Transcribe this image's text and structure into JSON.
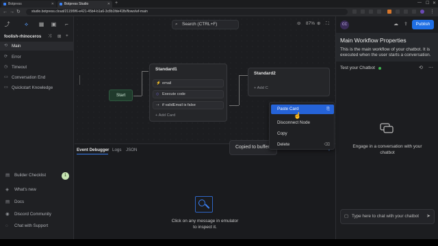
{
  "browser": {
    "tabs": [
      {
        "label": "Botpress"
      },
      {
        "label": "Botpress Studio"
      }
    ],
    "new_tab": "+",
    "url": "studio.botpress.cloud/2115f9f6-e421-45b4-b1a6-3c8b1fde41fb/flows/wf-main"
  },
  "toolbar": {
    "bot_name": "foolish-rhinoceros"
  },
  "workflows": [
    {
      "label": "Main",
      "active": true,
      "icon": "⟲"
    },
    {
      "label": "Error",
      "active": false,
      "icon": "⟳"
    },
    {
      "label": "Timeout",
      "active": false,
      "icon": "◷"
    },
    {
      "label": "Conversation End",
      "active": false,
      "icon": "▭"
    },
    {
      "label": "Quickstart Knowledge",
      "active": false,
      "icon": "▭"
    }
  ],
  "bottom_nav": [
    {
      "label": "Builder Checklist",
      "icon": "▤"
    },
    {
      "label": "What's new",
      "icon": "◈"
    },
    {
      "label": "Docs",
      "icon": "▤"
    },
    {
      "label": "Discord Community",
      "icon": "◉"
    },
    {
      "label": "Chat with Support",
      "icon": "◌"
    }
  ],
  "checklist_count": "1",
  "canvas": {
    "search_placeholder": "Search (CTRL+F)",
    "zoom": "87%"
  },
  "nodes": {
    "start": "Start",
    "standard1": {
      "title": "Standard1",
      "cards": [
        {
          "label": "email",
          "icon": "⚡"
        },
        {
          "label": "Execute code",
          "icon": "◇"
        },
        {
          "label": "if validEmail is false",
          "icon": "⇢"
        }
      ],
      "add_card": "+ Add Card"
    },
    "standard2": {
      "title": "Standard2",
      "add_card": "+ Add C"
    }
  },
  "context_menu": {
    "items": [
      {
        "label": "Paste Card",
        "shortcut": "⎘",
        "highlighted": true
      },
      {
        "label": "Disconnect Node",
        "shortcut": "",
        "highlighted": false
      },
      {
        "label": "Copy",
        "shortcut": "",
        "highlighted": false
      },
      {
        "label": "Delete",
        "shortcut": "⌫",
        "highlighted": false
      }
    ]
  },
  "toast": "Copied to buffer",
  "debugger": {
    "tabs": [
      "Event Debugger",
      "Logs",
      "JSON"
    ],
    "empty_line1": "Click on any message in emulator",
    "empty_line2": "to inspect it."
  },
  "right_panel": {
    "avatar": "CC",
    "publish": "Publish",
    "props_title": "Main Workflow Properties",
    "props_desc": "This is the main workflow of your chatbot. It is executed when the user starts a conversation.",
    "test_title": "Test your Chatbot",
    "chat_empty_line1": "Engage in a conversation with your",
    "chat_empty_line2": "chatbot",
    "chat_placeholder": "Type here to chat with your chatbot"
  },
  "colors": {
    "accent": "#2563d8",
    "publish": "#1f6fe5",
    "start_node": "#203a2c",
    "status_green": "#3fb950"
  }
}
